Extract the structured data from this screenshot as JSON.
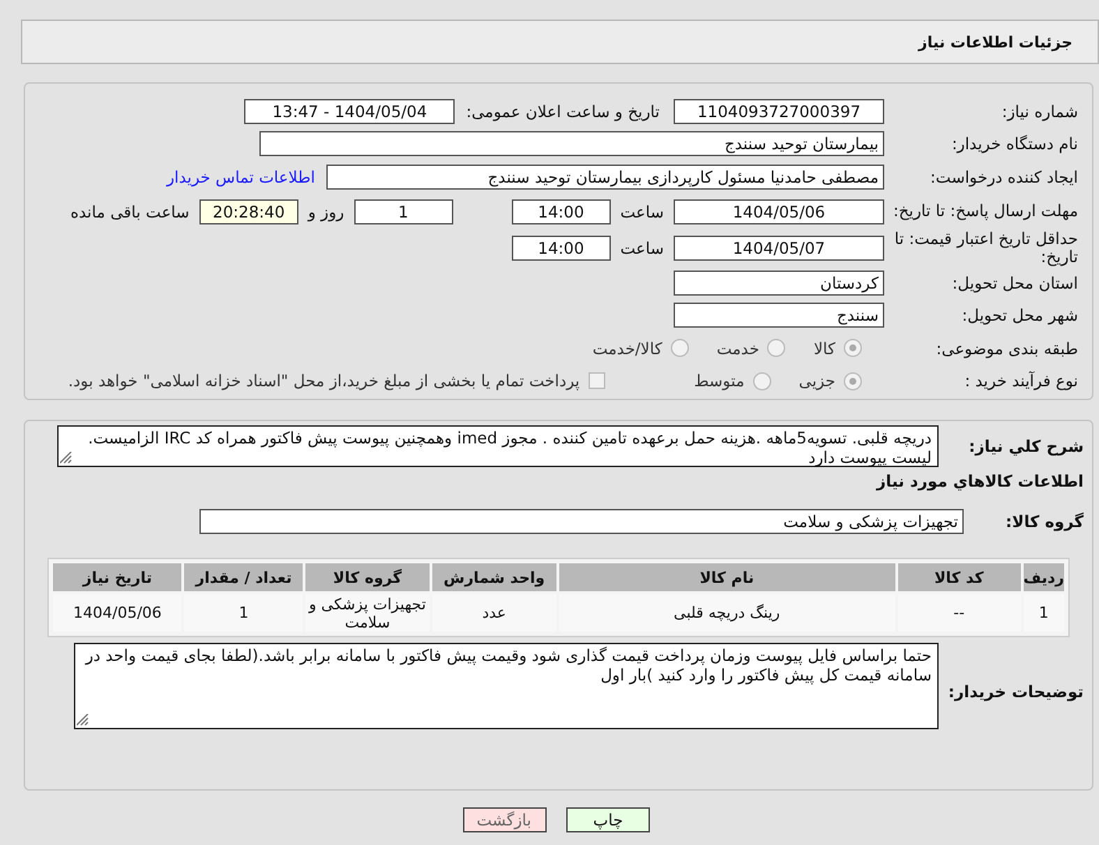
{
  "header": {
    "title": "جزئیات اطلاعات نیاز"
  },
  "form": {
    "need_number": {
      "label": "شماره نیاز:",
      "value": "1104093727000397"
    },
    "announce": {
      "label": "تاریخ و ساعت اعلان عمومی:",
      "value": "1404/05/04 - 13:47"
    },
    "buyer": {
      "label": "نام دستگاه خریدار:",
      "value": "بیمارستان توحید سنندج"
    },
    "requester": {
      "label": "ایجاد کننده درخواست:",
      "value": "مصطفی حامدنیا مسئول کارپردازی بیمارستان توحید سنندج",
      "contact_link": "اطلاعات تماس خریدار"
    },
    "reply_deadline": {
      "label": "مهلت ارسال پاسخ: تا تاریخ:",
      "date": "1404/05/06",
      "time_label": "ساعت",
      "time": "14:00",
      "days": "1",
      "days_label": "روز و",
      "remaining": "20:28:40",
      "remaining_label": "ساعت باقی مانده"
    },
    "price_validity": {
      "label": "حداقل تاریخ اعتبار قیمت: تا تاریخ:",
      "date": "1404/05/07",
      "time_label": "ساعت",
      "time": "14:00"
    },
    "province": {
      "label": "استان محل تحویل:",
      "value": "کردستان"
    },
    "city": {
      "label": "شهر محل تحویل:",
      "value": "سنندج"
    },
    "category": {
      "label": "طبقه بندی موضوعی:",
      "options": [
        {
          "label": "کالا",
          "selected": true
        },
        {
          "label": "خدمت",
          "selected": false
        },
        {
          "label": "کالا/خدمت",
          "selected": false
        }
      ]
    },
    "purchase_type": {
      "label": "نوع فرآیند خرید :",
      "options": [
        {
          "label": "جزیی",
          "selected": true
        },
        {
          "label": "متوسط",
          "selected": false
        }
      ],
      "payment_note": {
        "checked": false,
        "text": "پرداخت تمام یا بخشی از مبلغ خرید،از محل \"اسناد خزانه اسلامی\" خواهد بود."
      }
    }
  },
  "description": {
    "label": "شرح کلي نياز:",
    "text": "دریچه قلبی. تسویه5ماهه .هزینه حمل برعهده تامین کننده . مجوز imed وهمچنین پیوست پیش فاکتور همراه کد IRC  الزامیست. لیست پیوست دارد"
  },
  "items": {
    "title": "اطلاعات کالاهاي مورد نياز",
    "group_label": "گروه کالا:",
    "group_value": "تجهیزات پزشکی و سلامت",
    "table": {
      "columns": [
        "ردیف",
        "کد کالا",
        "نام کالا",
        "واحد شمارش",
        "گروه کالا",
        "تعداد / مقدار",
        "تاریخ نیاز"
      ],
      "rows": [
        [
          "1",
          "--",
          "رینگ دریچه قلبی",
          "عدد",
          "تجهیزات پزشکی و سلامت",
          "1",
          "1404/05/06"
        ]
      ]
    }
  },
  "buyer_notes": {
    "label": "توضیحات خریدار:",
    "text": "حتما براساس فایل پیوست  وزمان پرداخت قیمت گذاری شود وقیمت پیش فاکتور با سامانه برابر باشد.(لطفا بجای قیمت واحد در سامانه قیمت کل پیش فاکتور را وارد کنید )بار اول"
  },
  "buttons": [
    {
      "label": "چاپ",
      "kind": "print"
    },
    {
      "label": "بازگشت",
      "kind": "back"
    }
  ]
}
